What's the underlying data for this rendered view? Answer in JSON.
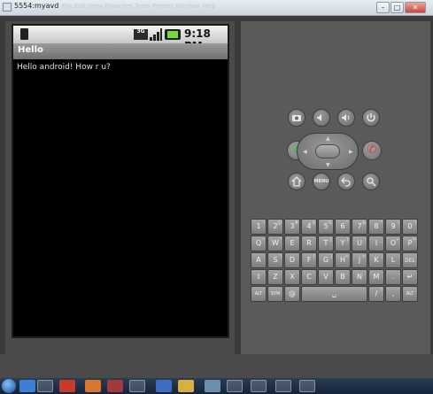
{
  "window": {
    "title": "5554:myavd",
    "menu_hint": "File   Edit   View   Favorites   Tools   Project   Window   Help"
  },
  "window_controls": {
    "minimize": "–",
    "maximize": "□",
    "close": "✕"
  },
  "statusbar": {
    "network": "3G",
    "time": "9:18 PM"
  },
  "app": {
    "title": "Hello",
    "message": "Hello android! How r u?"
  },
  "controls": {
    "dpad_icon": "dpad-icon",
    "call": "✆",
    "end": "✆",
    "menu": "MENU"
  },
  "keyboard": {
    "row1": [
      {
        "k": "1",
        "s": "!"
      },
      {
        "k": "2",
        "s": "@"
      },
      {
        "k": "3",
        "s": "#"
      },
      {
        "k": "4",
        "s": "$"
      },
      {
        "k": "5",
        "s": "%"
      },
      {
        "k": "6",
        "s": "^"
      },
      {
        "k": "7",
        "s": "&"
      },
      {
        "k": "8",
        "s": "*"
      },
      {
        "k": "9",
        "s": "("
      },
      {
        "k": "0",
        "s": ")"
      }
    ],
    "row2": [
      {
        "k": "Q",
        "s": "~"
      },
      {
        "k": "W",
        "s": "\""
      },
      {
        "k": "E",
        "s": "´"
      },
      {
        "k": "R",
        "s": ""
      },
      {
        "k": "T",
        "s": "{"
      },
      {
        "k": "Y",
        "s": "}"
      },
      {
        "k": "U",
        "s": "-"
      },
      {
        "k": "I",
        "s": "_"
      },
      {
        "k": "O",
        "s": "+"
      },
      {
        "k": "P",
        "s": "="
      }
    ],
    "row3": [
      {
        "k": "A",
        "s": ""
      },
      {
        "k": "S",
        "s": "\\"
      },
      {
        "k": "D",
        "s": ""
      },
      {
        "k": "F",
        "s": "["
      },
      {
        "k": "G",
        "s": "]"
      },
      {
        "k": "H",
        "s": "<"
      },
      {
        "k": "J",
        "s": ">"
      },
      {
        "k": "K",
        "s": ";"
      },
      {
        "k": "L",
        "s": ":"
      },
      {
        "k": "DEL",
        "s": ""
      }
    ],
    "row4": [
      {
        "k": "⇧",
        "s": ""
      },
      {
        "k": "Z",
        "s": ""
      },
      {
        "k": "X",
        "s": ""
      },
      {
        "k": "C",
        "s": ""
      },
      {
        "k": "V",
        "s": ""
      },
      {
        "k": "B",
        "s": ""
      },
      {
        "k": "N",
        "s": ""
      },
      {
        "k": "M",
        "s": ""
      },
      {
        "k": ".",
        "s": ","
      },
      {
        "k": "↵",
        "s": ""
      }
    ],
    "row5": [
      {
        "k": "ALT",
        "s": ""
      },
      {
        "k": "SYM",
        "s": ""
      },
      {
        "k": "@",
        "s": ""
      },
      {
        "k": "␣",
        "s": ""
      },
      {
        "k": "/",
        "s": "?"
      },
      {
        "k": ",",
        "s": ""
      },
      {
        "k": "ALT",
        "s": ""
      }
    ]
  },
  "taskbar": {
    "items": [
      "start",
      "ie",
      "chrome",
      "opera",
      "firefox",
      "app",
      "explorer",
      "word",
      "folder",
      "media",
      "eclipse",
      "avd",
      "misc"
    ]
  }
}
